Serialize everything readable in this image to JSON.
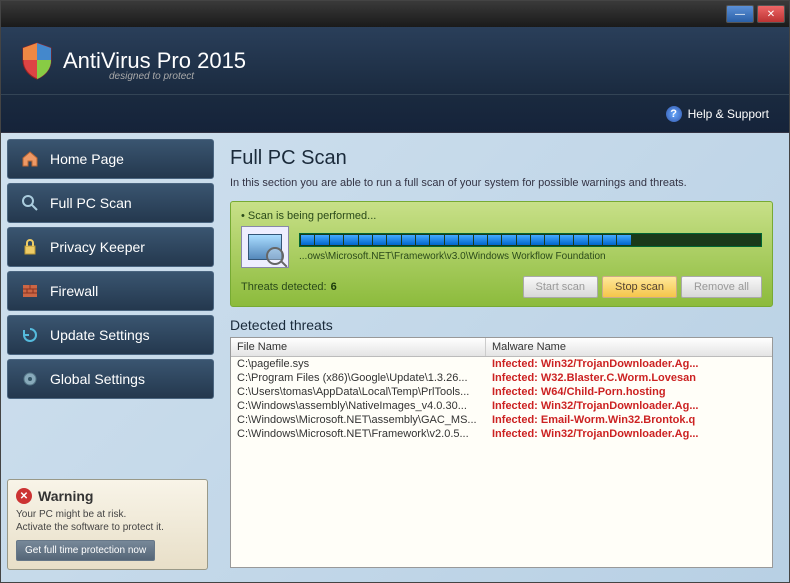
{
  "app": {
    "title": "AntiVirus Pro 2015",
    "subtitle": "designed to protect"
  },
  "help": {
    "label": "Help & Support"
  },
  "nav": [
    {
      "label": "Home Page"
    },
    {
      "label": "Full PC Scan"
    },
    {
      "label": "Privacy Keeper"
    },
    {
      "label": "Firewall"
    },
    {
      "label": "Update Settings"
    },
    {
      "label": "Global Settings"
    }
  ],
  "warning": {
    "title": "Warning",
    "line1": "Your PC might be at risk.",
    "line2": "Activate the software to protect it.",
    "button": "Get full time protection now"
  },
  "main": {
    "title": "Full PC Scan",
    "desc": "In this section you are able to run a full scan of your system for possible warnings and threats."
  },
  "scan": {
    "status": "Scan is being performed...",
    "path": "...ows\\Microsoft.NET\\Framework\\v3.0\\Windows Workflow Foundation",
    "threats_label": "Threats detected:",
    "threats_count": "6",
    "progress_filled": 23,
    "progress_total": 32,
    "btn_start": "Start scan",
    "btn_stop": "Stop scan",
    "btn_remove": "Remove all"
  },
  "table": {
    "title": "Detected threats",
    "col_file": "File Name",
    "col_malware": "Malware Name",
    "rows": [
      {
        "file": "C:\\pagefile.sys",
        "mal": "Infected: Win32/TrojanDownloader.Ag..."
      },
      {
        "file": "C:\\Program Files (x86)\\Google\\Update\\1.3.26...",
        "mal": "Infected: W32.Blaster.C.Worm.Lovesan"
      },
      {
        "file": "C:\\Users\\tomas\\AppData\\Local\\Temp\\PrlTools...",
        "mal": "Infected: W64/Child-Porn.hosting"
      },
      {
        "file": "C:\\Windows\\assembly\\NativeImages_v4.0.30...",
        "mal": "Infected: Win32/TrojanDownloader.Ag..."
      },
      {
        "file": "C:\\Windows\\Microsoft.NET\\assembly\\GAC_MS...",
        "mal": "Infected: Email-Worm.Win32.Brontok.q"
      },
      {
        "file": "C:\\Windows\\Microsoft.NET\\Framework\\v2.0.5...",
        "mal": "Infected: Win32/TrojanDownloader.Ag..."
      }
    ]
  }
}
